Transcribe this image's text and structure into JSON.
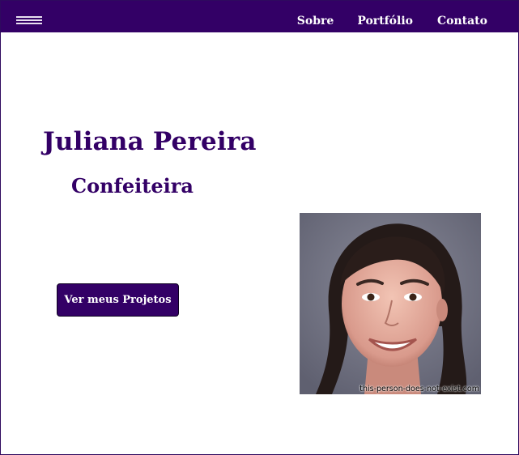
{
  "nav": {
    "menu_icon": "hamburger-icon",
    "links": [
      "Sobre",
      "Portfólio",
      "Contato"
    ]
  },
  "hero": {
    "name": "Juliana Pereira",
    "role": "Confeiteira",
    "cta_label": "Ver meus Projetos"
  },
  "photo": {
    "watermark": "this-person-does-not-exist.com"
  },
  "colors": {
    "brand": "#330066",
    "background": "#ffffff",
    "nav_text": "#ffffff"
  }
}
